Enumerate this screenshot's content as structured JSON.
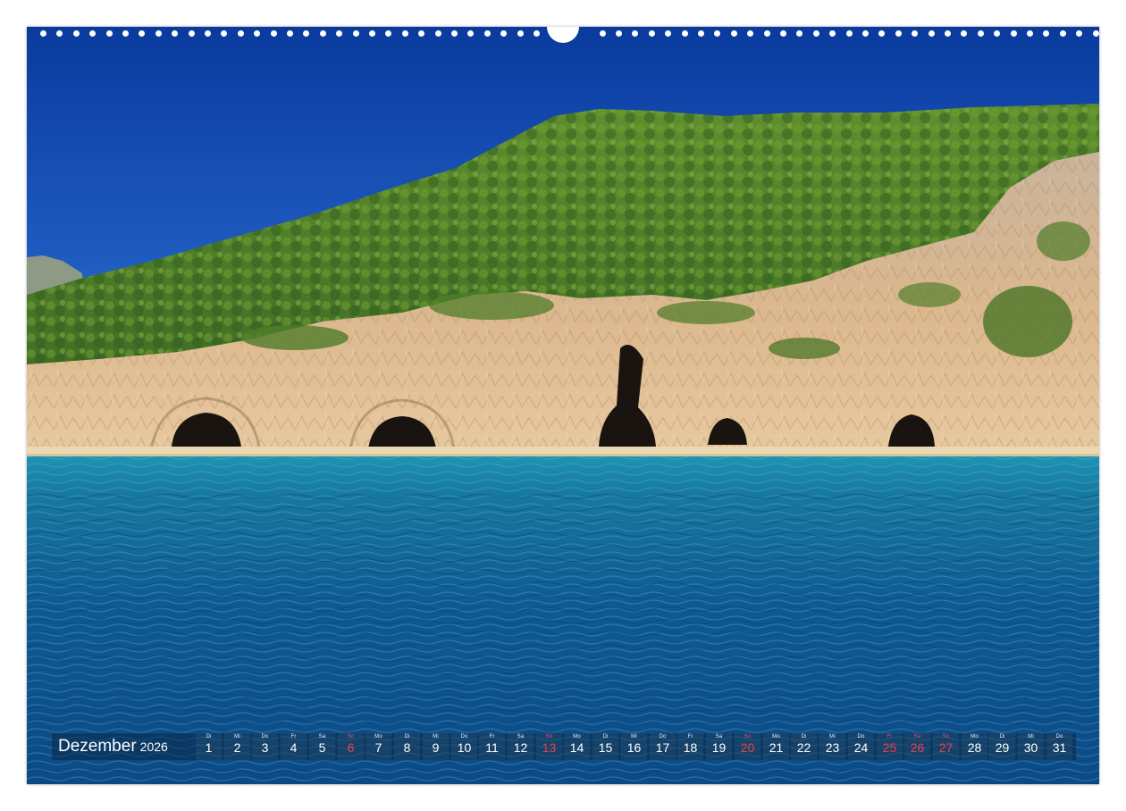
{
  "scene": {
    "subject": "",
    "colors": {
      "sky_top": "#0b3fa8",
      "sky_bottom": "#3f7ed2",
      "sea_top": "#1f8fb1",
      "sea_deep": "#0e4f8c",
      "forest": "#4c7a2a",
      "rock": "#d9b48a",
      "cave": "#1a1410",
      "beach": "#ecd9b4"
    }
  },
  "calendar": {
    "month": "Dezember",
    "year": "2026",
    "days": [
      {
        "wd": "Di",
        "num": "1",
        "type": "weekday"
      },
      {
        "wd": "Mi",
        "num": "2",
        "type": "weekday"
      },
      {
        "wd": "Do",
        "num": "3",
        "type": "weekday"
      },
      {
        "wd": "Fr",
        "num": "4",
        "type": "weekday"
      },
      {
        "wd": "Sa",
        "num": "5",
        "type": "weekday"
      },
      {
        "wd": "So",
        "num": "6",
        "type": "sunday"
      },
      {
        "wd": "Mo",
        "num": "7",
        "type": "weekday"
      },
      {
        "wd": "Di",
        "num": "8",
        "type": "weekday"
      },
      {
        "wd": "Mi",
        "num": "9",
        "type": "weekday"
      },
      {
        "wd": "Do",
        "num": "10",
        "type": "weekday"
      },
      {
        "wd": "Fr",
        "num": "11",
        "type": "weekday"
      },
      {
        "wd": "Sa",
        "num": "12",
        "type": "weekday"
      },
      {
        "wd": "So",
        "num": "13",
        "type": "sunday"
      },
      {
        "wd": "Mo",
        "num": "14",
        "type": "weekday"
      },
      {
        "wd": "Di",
        "num": "15",
        "type": "weekday"
      },
      {
        "wd": "Mi",
        "num": "16",
        "type": "weekday"
      },
      {
        "wd": "Do",
        "num": "17",
        "type": "weekday"
      },
      {
        "wd": "Fr",
        "num": "18",
        "type": "weekday"
      },
      {
        "wd": "Sa",
        "num": "19",
        "type": "weekday"
      },
      {
        "wd": "So",
        "num": "20",
        "type": "sunday"
      },
      {
        "wd": "Mo",
        "num": "21",
        "type": "weekday"
      },
      {
        "wd": "Di",
        "num": "22",
        "type": "weekday"
      },
      {
        "wd": "Mi",
        "num": "23",
        "type": "weekday"
      },
      {
        "wd": "Do",
        "num": "24",
        "type": "weekday"
      },
      {
        "wd": "Fr",
        "num": "25",
        "type": "holiday"
      },
      {
        "wd": "Sa",
        "num": "26",
        "type": "holiday"
      },
      {
        "wd": "So",
        "num": "27",
        "type": "sunday"
      },
      {
        "wd": "Mo",
        "num": "28",
        "type": "weekday"
      },
      {
        "wd": "Di",
        "num": "29",
        "type": "weekday"
      },
      {
        "wd": "Mi",
        "num": "30",
        "type": "weekday"
      },
      {
        "wd": "Do",
        "num": "31",
        "type": "weekday"
      }
    ]
  }
}
